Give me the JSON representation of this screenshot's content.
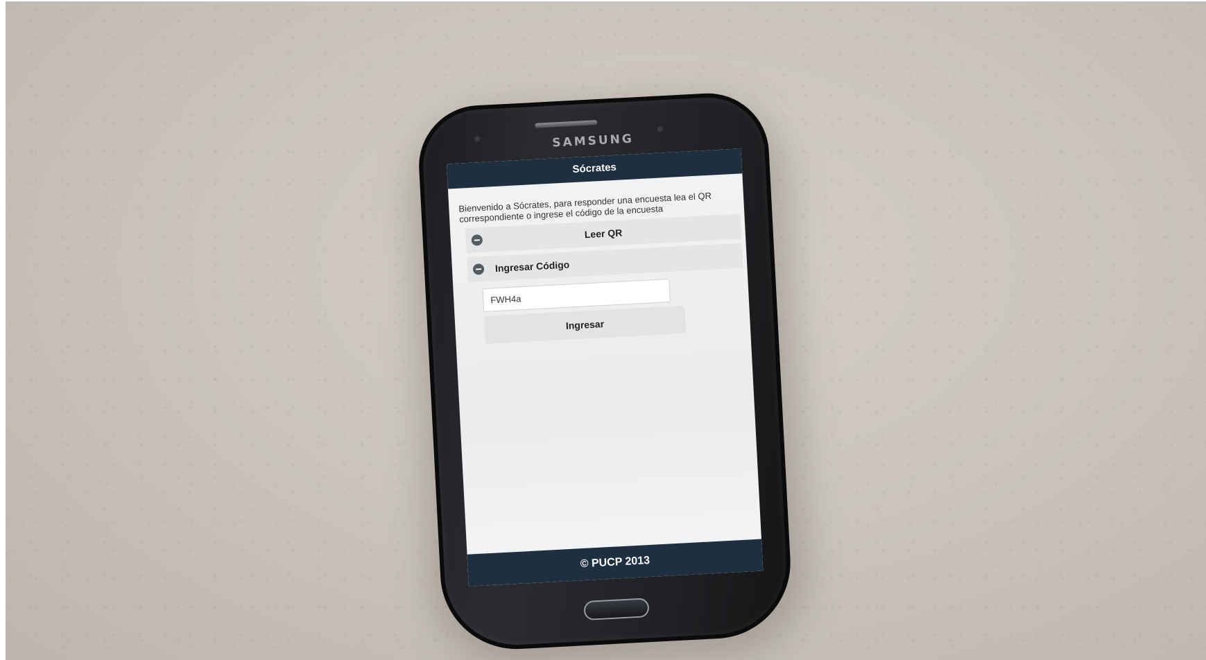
{
  "device": {
    "brand": "SAMSUNG"
  },
  "app": {
    "title": "Sócrates",
    "intro": "Bienvenido a Sócrates, para responder una encuesta lea el QR correspondiente o ingrese el código de la encuesta",
    "read_qr_label": "Leer QR",
    "enter_code_label": "Ingresar Código",
    "code_value": "FWH4a",
    "submit_label": "Ingresar",
    "footer": "© PUCP 2013"
  },
  "icons": {
    "read_qr": "minus-circle-icon",
    "enter_code": "minus-circle-icon"
  },
  "colors": {
    "header_bg": "#1e2f3f",
    "button_bg": "#e4e5e7"
  }
}
